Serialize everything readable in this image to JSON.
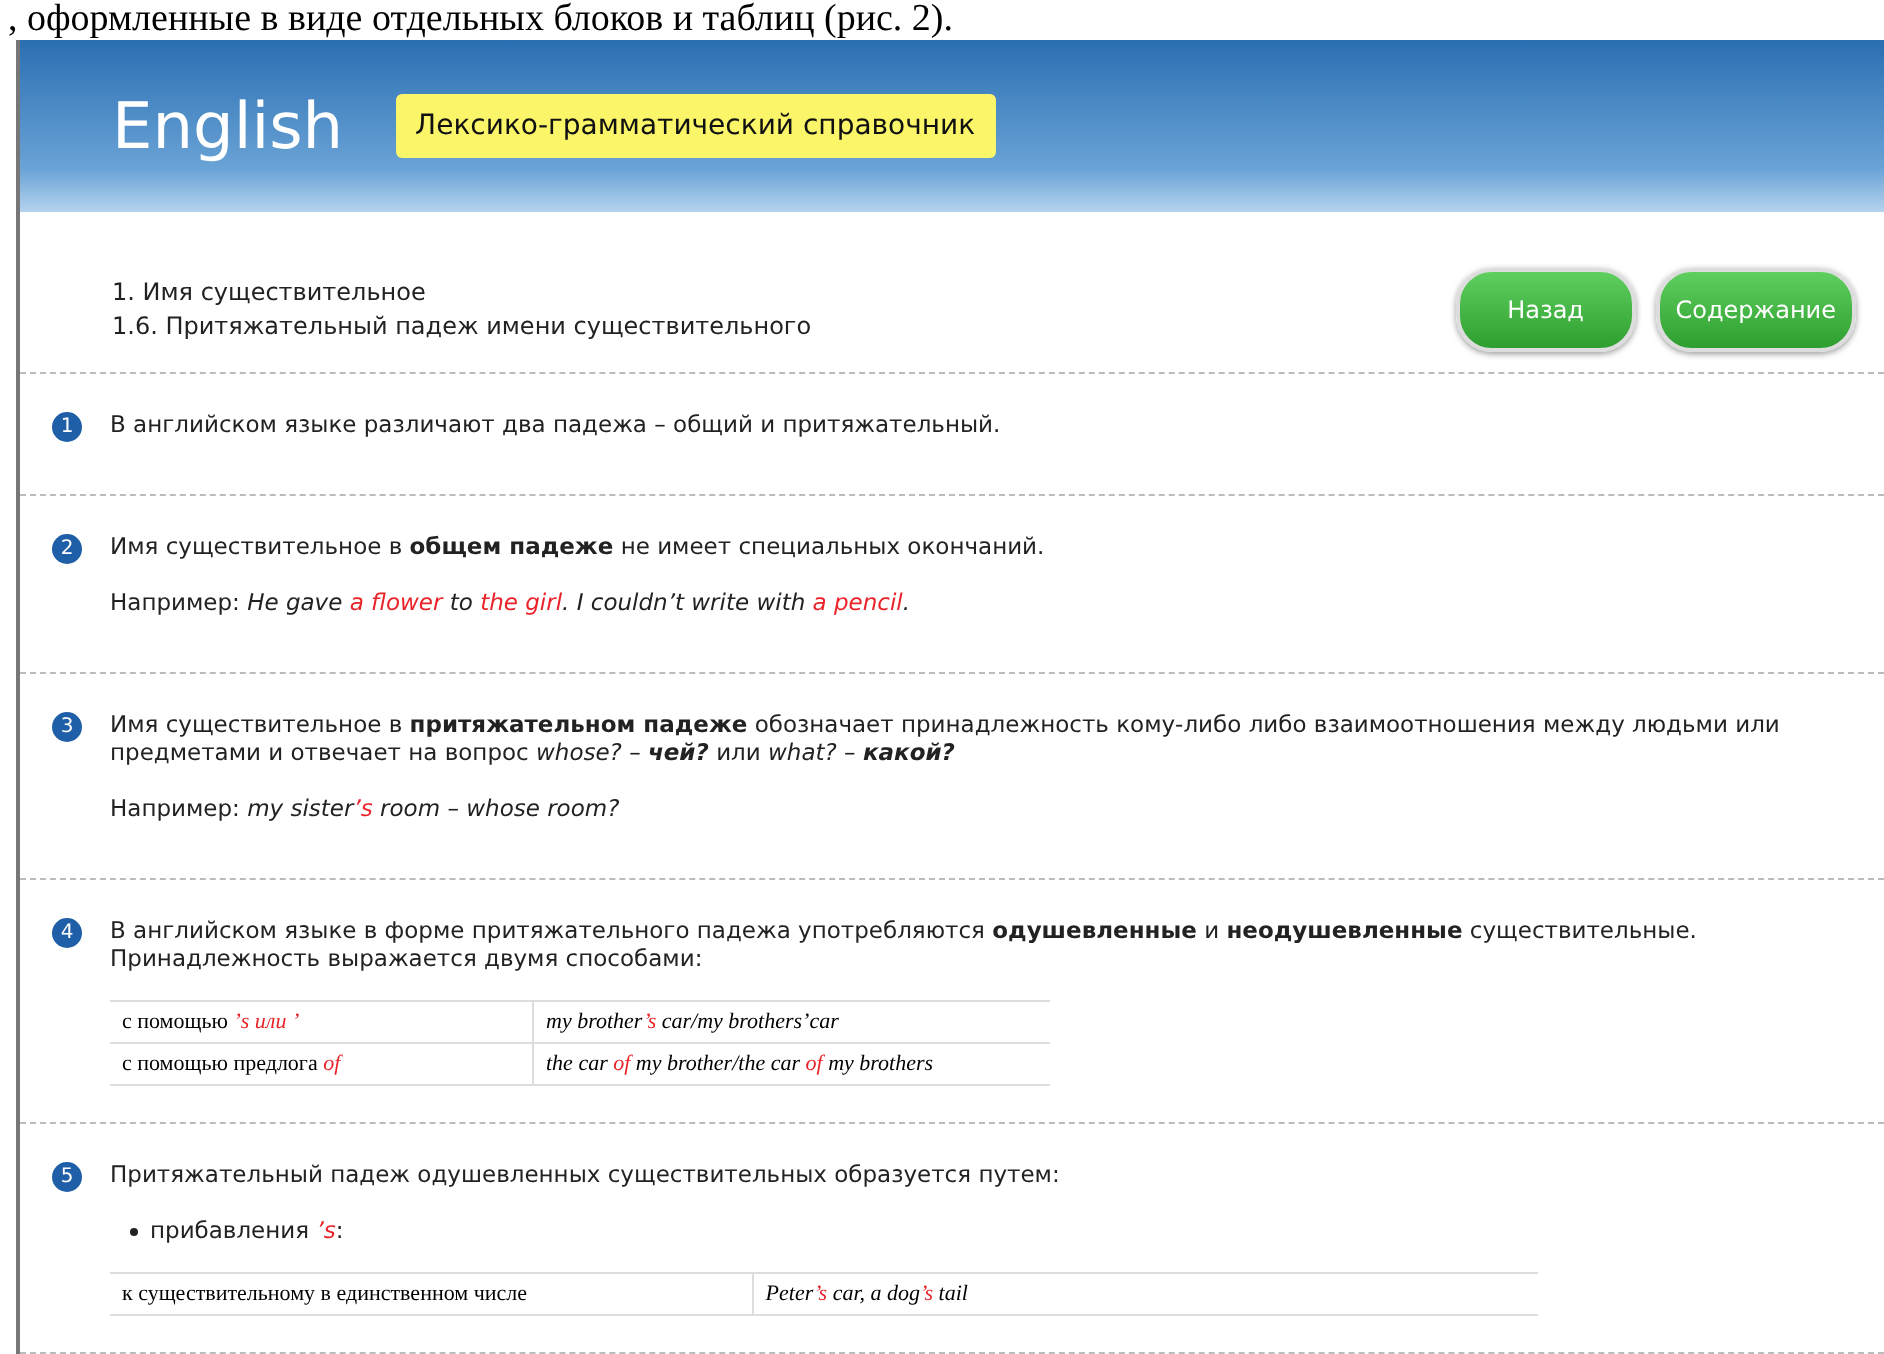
{
  "caption": ", оформленные в виде отдельных блоков и таблиц (рис. 2).",
  "header": {
    "logo": "English",
    "subtitle": "Лексико-грамматический справочник"
  },
  "breadcrumb": [
    "1. Имя существительное",
    "1.6. Притяжательный падеж имени существительного"
  ],
  "buttons": [
    "Назад",
    "Содержание"
  ],
  "sections": [
    {
      "number": "1",
      "blocks": [
        {
          "kind": "paragraph",
          "segments": [
            {
              "text": "В английском языке различают два падежа – общий и притяжательный.",
              "kind": "plain"
            }
          ]
        }
      ]
    },
    {
      "number": "2",
      "blocks": [
        {
          "kind": "paragraph",
          "segments": [
            {
              "text": "Имя существительное в ",
              "kind": "plain"
            },
            {
              "text": "общем падеже",
              "kind": "bold"
            },
            {
              "text": " не имеет специальных окончаний.",
              "kind": "plain"
            }
          ]
        },
        {
          "kind": "paragraph",
          "segments": [
            {
              "text": "Например: ",
              "kind": "plain"
            },
            {
              "text": "He gave ",
              "kind": "italic"
            },
            {
              "text": "a flower",
              "kind": "highlight"
            },
            {
              "text": " to ",
              "kind": "italic"
            },
            {
              "text": "the girl",
              "kind": "highlight"
            },
            {
              "text": ". I couldn’t write with ",
              "kind": "italic"
            },
            {
              "text": "a pencil",
              "kind": "highlight"
            },
            {
              "text": ".",
              "kind": "italic"
            }
          ]
        }
      ]
    },
    {
      "number": "3",
      "blocks": [
        {
          "kind": "paragraph",
          "segments": [
            {
              "text": "Имя существительное в ",
              "kind": "plain"
            },
            {
              "text": "притяжательном падеже",
              "kind": "bold"
            },
            {
              "text": " обозначает принадлежность кому-либо либо взаимоотношения между людьми или предметами и отвечает на вопрос ",
              "kind": "plain"
            },
            {
              "text": "whose?",
              "kind": "italic"
            },
            {
              "text": " – ",
              "kind": "plain"
            },
            {
              "text": "чей?",
              "kind": "emphasis"
            },
            {
              "text": " или ",
              "kind": "plain"
            },
            {
              "text": "what?",
              "kind": "italic"
            },
            {
              "text": " – ",
              "kind": "plain"
            },
            {
              "text": "какой?",
              "kind": "emphasis"
            }
          ]
        },
        {
          "kind": "paragraph",
          "segments": [
            {
              "text": "Например: ",
              "kind": "plain"
            },
            {
              "text": "my sister",
              "kind": "italic"
            },
            {
              "text": "’s",
              "kind": "highlight"
            },
            {
              "text": " room",
              "kind": "italic"
            },
            {
              "text": " – ",
              "kind": "plain"
            },
            {
              "text": "whose room?",
              "kind": "italic"
            }
          ]
        }
      ]
    },
    {
      "number": "4",
      "blocks": [
        {
          "kind": "paragraph",
          "segments": [
            {
              "text": "В английском языке в форме притяжательного падежа употребляются ",
              "kind": "plain"
            },
            {
              "text": "одушевленные",
              "kind": "bold"
            },
            {
              "text": " и ",
              "kind": "plain"
            },
            {
              "text": "неодушевленные",
              "kind": "bold"
            },
            {
              "text": " существительные. Принадлежность выражается двумя способами:",
              "kind": "plain"
            }
          ]
        },
        {
          "kind": "table",
          "rows": [
            [
              [
                {
                  "text": "с помощью ",
                  "kind": "plain"
                },
                {
                  "text": "’s или ’",
                  "kind": "highlight"
                }
              ],
              [
                {
                  "text": "my brother",
                  "kind": "italic"
                },
                {
                  "text": "’s",
                  "kind": "highlight"
                },
                {
                  "text": " car/my brothers’car",
                  "kind": "italic"
                }
              ]
            ],
            [
              [
                {
                  "text": "с помощью предлога ",
                  "kind": "plain"
                },
                {
                  "text": "of",
                  "kind": "highlight"
                }
              ],
              [
                {
                  "text": "the car ",
                  "kind": "italic"
                },
                {
                  "text": "of",
                  "kind": "highlight"
                },
                {
                  "text": " my brother/the car ",
                  "kind": "italic"
                },
                {
                  "text": "of",
                  "kind": "highlight"
                },
                {
                  "text": " my brothers",
                  "kind": "italic"
                }
              ]
            ]
          ]
        }
      ]
    },
    {
      "number": "5",
      "blocks": [
        {
          "kind": "paragraph",
          "segments": [
            {
              "text": "Притяжательный падеж одушевленных существительных образуется путем:",
              "kind": "plain"
            }
          ]
        },
        {
          "kind": "bullet",
          "segments": [
            {
              "text": "прибавления ",
              "kind": "plain"
            },
            {
              "text": "’s",
              "kind": "highlight"
            },
            {
              "text": ":",
              "kind": "plain"
            }
          ]
        },
        {
          "kind": "table",
          "rows": [
            [
              [
                {
                  "text": "к существительному в единственном числе",
                  "kind": "plain"
                }
              ],
              [
                {
                  "text": "Peter",
                  "kind": "italic"
                },
                {
                  "text": "’s",
                  "kind": "highlight"
                },
                {
                  "text": " car, a dog",
                  "kind": "italic"
                },
                {
                  "text": "’s",
                  "kind": "highlight"
                },
                {
                  "text": " tail",
                  "kind": "italic"
                }
              ]
            ]
          ]
        }
      ]
    }
  ]
}
